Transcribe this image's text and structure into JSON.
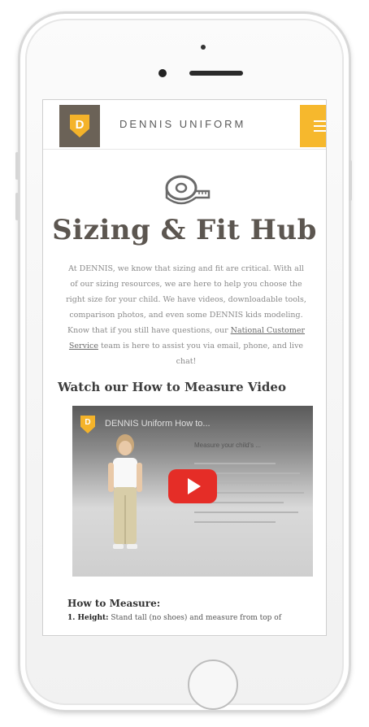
{
  "header": {
    "logo_letter": "D",
    "brand": "DENNIS UNIFORM",
    "menu_icon": "hamburger-menu-icon"
  },
  "page": {
    "icon": "measuring-tape-icon",
    "title": "Sizing & Fit Hub",
    "intro_before_link": "At DENNIS, we know that sizing and fit are critical. With all of our sizing resources, we are here to help you choose the right size for your child. We have videos, downloadable tools, comparison photos, and even some DENNIS kids modeling. Know that if you still have questions, our ",
    "intro_link": "National Customer Service",
    "intro_after_link": " team is here to assist you via email, phone, and live chat!"
  },
  "video": {
    "heading": "Watch our How to Measure Video",
    "title": "DENNIS Uniform How to...",
    "subtitle": "Measure your child's ...",
    "play_icon": "youtube-play-icon",
    "logo_letter": "D"
  },
  "measure": {
    "heading": "How to Measure:",
    "item1_label": "1. Height:",
    "item1_text": " Stand tall (no shoes) and measure from top of"
  },
  "colors": {
    "accent": "#f6b82d",
    "logo_bg": "#6b6257",
    "title": "#5c5650",
    "play": "#e52d27"
  }
}
